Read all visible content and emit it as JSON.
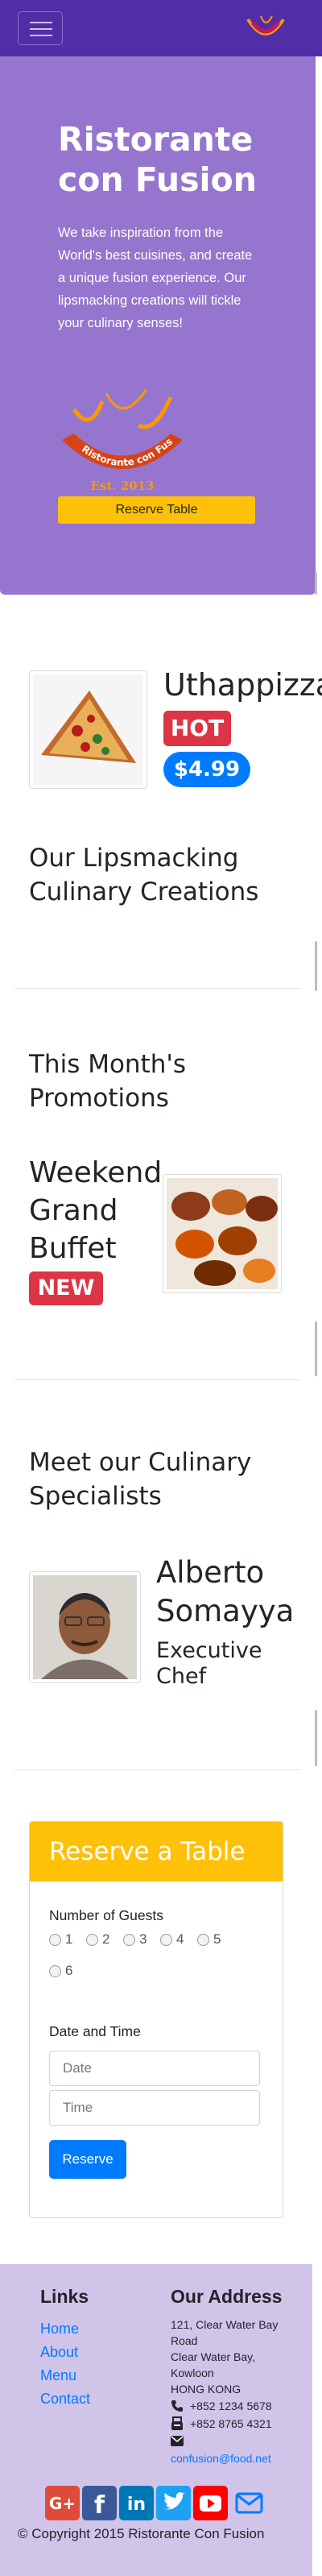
{
  "navbar": {
    "logo_icon": "restaurant-logo-icon",
    "toggle_icon": "hamburger-icon"
  },
  "jumbotron": {
    "title": "Ristorante con Fusion",
    "description": "We take inspiration from the World's best cuisines, and create a unique fusion experience. Our lipsmacking creations will tickle your culinary senses!",
    "logo_text": "Ristorante con Fusion",
    "logo_est": "Est. 2013",
    "button": "Reserve Table"
  },
  "dish": {
    "name": "Uthappizza",
    "badge": "HOT",
    "price": "$4.99",
    "heading": "Our Lipsmacking Culinary Creations"
  },
  "promotion": {
    "heading": "This Month's Promotions",
    "name": "Weekend Grand Buffet",
    "badge": "NEW"
  },
  "leader": {
    "heading": "Meet our Culinary Specialists",
    "name": "Alberto Somayya",
    "title": "Executive Chef"
  },
  "reserve": {
    "title": "Reserve a Table",
    "guests_label": "Number of Guests",
    "guests_options": [
      "1",
      "2",
      "3",
      "4",
      "5",
      "6"
    ],
    "datetime_label": "Date and Time",
    "date_placeholder": "Date",
    "time_placeholder": "Time",
    "button": "Reserve"
  },
  "footer": {
    "links_heading": "Links",
    "links": [
      "Home",
      "About",
      "Menu",
      "Contact"
    ],
    "address_heading": "Our Address",
    "address": [
      "121, Clear Water Bay",
      "Road",
      "Clear Water Bay,",
      "Kowloon",
      "HONG KONG"
    ],
    "phone": "+852 1234 5678",
    "fax": "+852 8765 4321",
    "email": "confusion@food.net",
    "social_icons": [
      "google-plus-icon",
      "facebook-icon",
      "linkedin-icon",
      "twitter-icon",
      "youtube-icon",
      "mail-icon"
    ],
    "copyright": "© Copyright 2015 Ristorante Con Fusion"
  },
  "colors": {
    "primary": "#512DA8",
    "jumbotron": "#9575CD",
    "accent": "#FFC107",
    "footer": "#D1C4E9",
    "danger": "#dc3545",
    "link": "#007bff"
  }
}
